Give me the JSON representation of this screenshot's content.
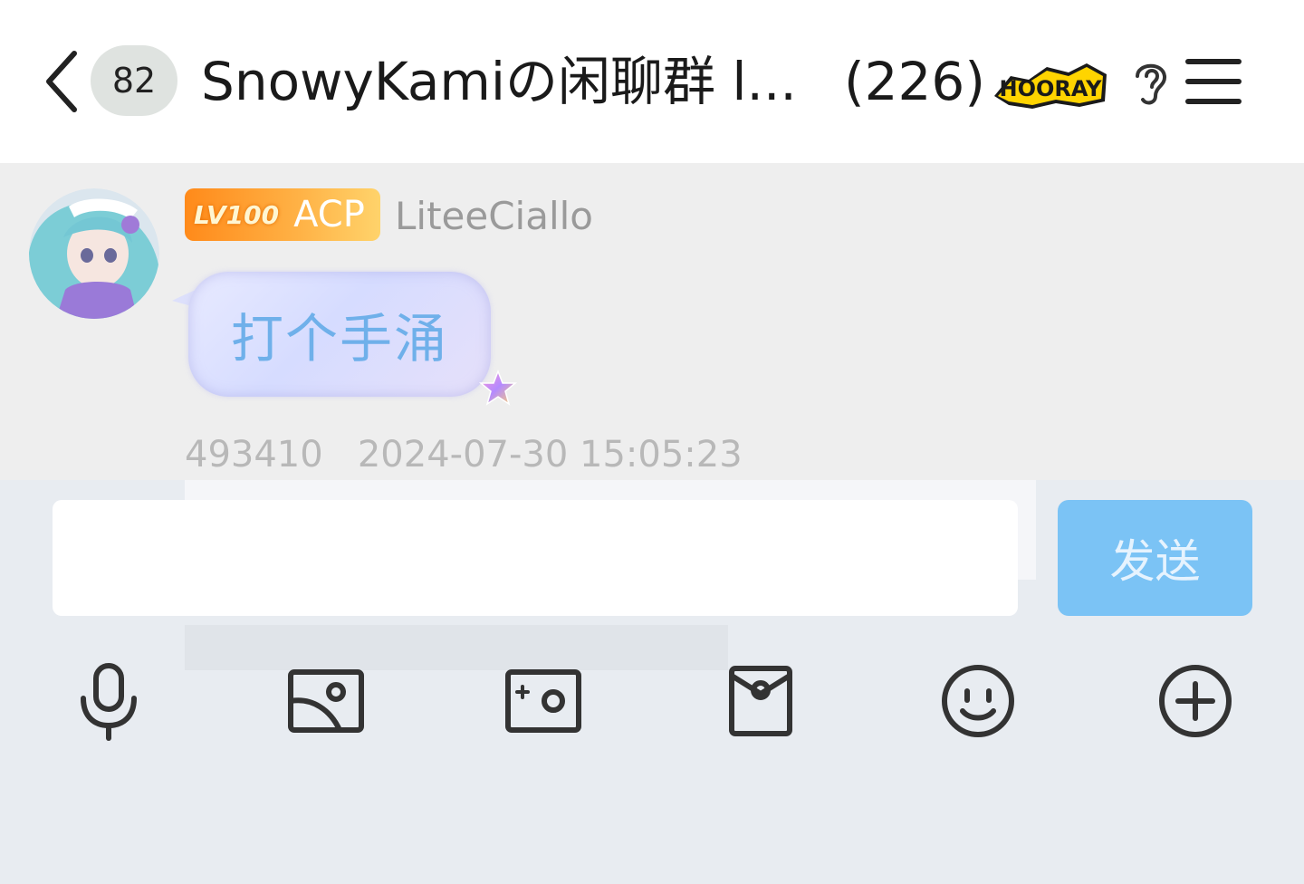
{
  "header": {
    "unread_count": "82",
    "chat_title": "SnowyKamiの闲聊群 l...",
    "member_count": "(226)",
    "hooray_badge_text": "HOORAY"
  },
  "message": {
    "level": "LV100",
    "title_badge": "ACP",
    "sender": "LiteeCiallo",
    "text": "打个手涌",
    "meta": "493410   2024-07-30 15:05:23"
  },
  "composer": {
    "input_value": "",
    "send_label": "发送"
  },
  "toolbar": {
    "items": [
      "microphone-icon",
      "image-icon",
      "camera-icon",
      "red-packet-icon",
      "emoji-icon",
      "plus-icon"
    ]
  },
  "colors": {
    "accent": "#7bc3f5",
    "bubble_text": "#6fb0ea",
    "badge_orange": "#ff8a1a"
  }
}
